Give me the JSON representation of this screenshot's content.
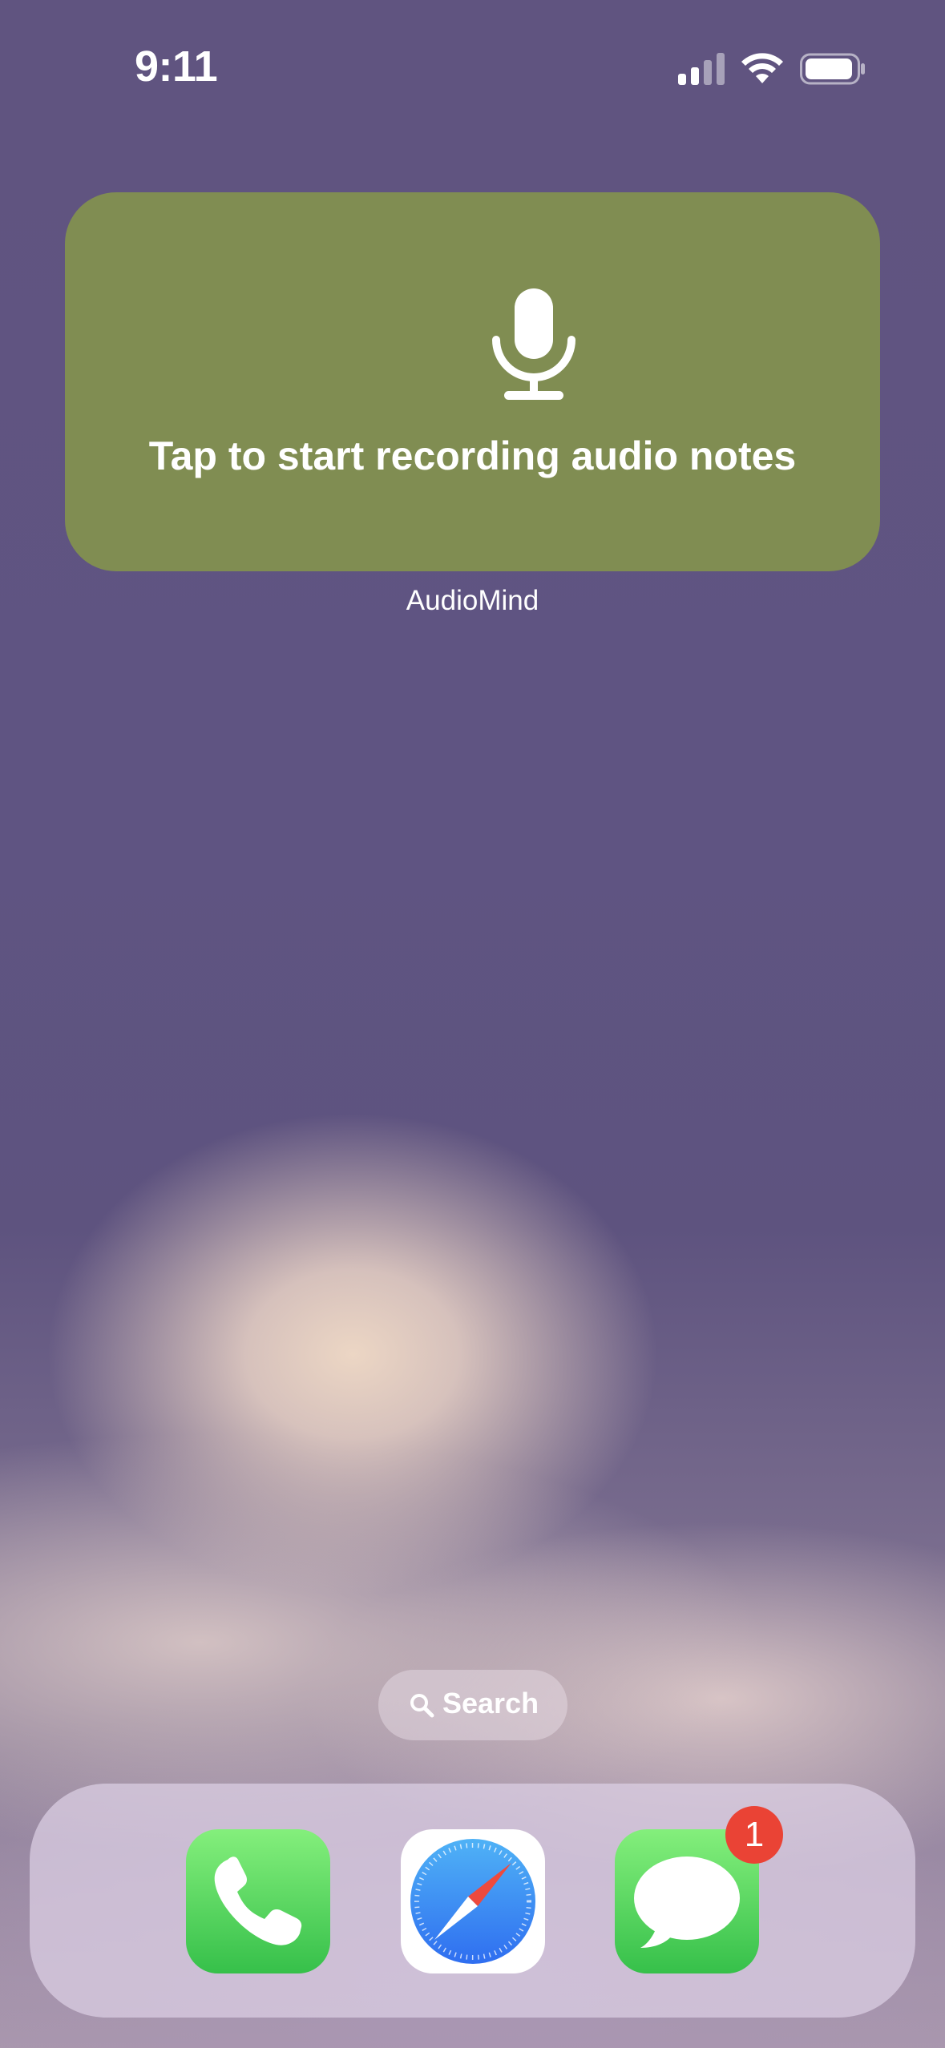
{
  "status_bar": {
    "time": "9:11",
    "icons": [
      "signal-icon",
      "wifi-icon",
      "battery-icon"
    ]
  },
  "widget": {
    "icon": "microphone-icon",
    "text": "Tap to start recording audio notes",
    "app_label": "AudioMind",
    "background_color": "#808d52"
  },
  "search": {
    "icon": "search-icon",
    "label": "Search"
  },
  "dock": {
    "apps": [
      {
        "name": "Phone",
        "icon": "phone-icon"
      },
      {
        "name": "Safari",
        "icon": "safari-compass-icon"
      },
      {
        "name": "Messages",
        "icon": "messages-bubble-icon",
        "badge": "1"
      }
    ]
  },
  "colors": {
    "badge": "#ea4335",
    "app_green": "#36c04a",
    "safari_blue": "#3a86f0"
  }
}
